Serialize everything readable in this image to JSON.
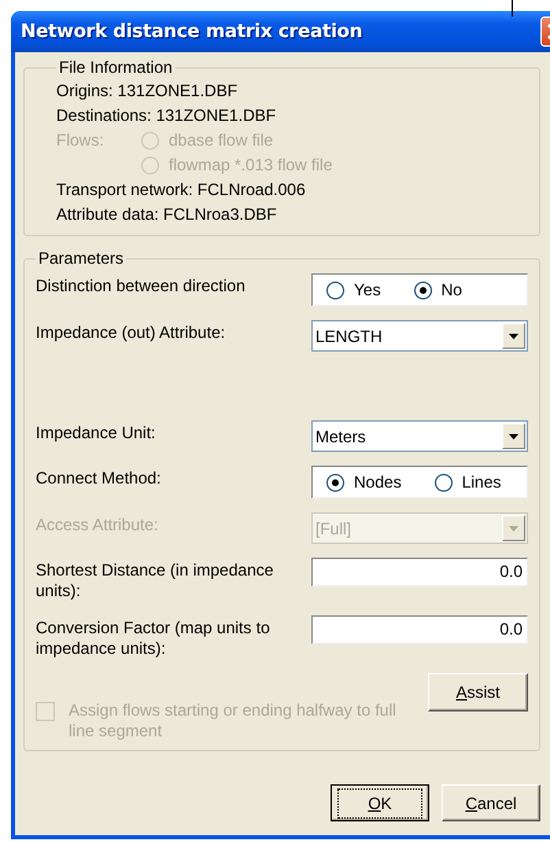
{
  "window": {
    "title": "Network distance matrix creation"
  },
  "file_info": {
    "title": "File Information",
    "items": [
      {
        "kind": "text",
        "text": "Origins: 131ZONE1.DBF"
      },
      {
        "kind": "text",
        "text": "Destinations: 131ZONE1.DBF"
      },
      {
        "kind": "radios",
        "label": "Flows:",
        "disabled": true,
        "options": [
          {
            "label": "dbase flow file",
            "selected": false
          },
          {
            "label": "flowmap *.013 flow file",
            "selected": false
          }
        ]
      },
      {
        "kind": "text",
        "text": "Transport network: FCLNroad.006"
      },
      {
        "kind": "text",
        "text": "Attribute data: FCLNroa3.DBF"
      }
    ]
  },
  "parameters": {
    "title": "Parameters",
    "rows": [
      {
        "kind": "radio",
        "label": "Distinction between direction",
        "disabled": false,
        "options": [
          {
            "label": "Yes",
            "selected": false
          },
          {
            "label": "No",
            "selected": true
          }
        ]
      },
      {
        "kind": "dropdown",
        "label": "Impedance (out) Attribute:",
        "value": "LENGTH",
        "disabled": false
      },
      {
        "kind": "dropdown",
        "label": "Impedance Unit:",
        "value": "Meters",
        "disabled": false
      },
      {
        "kind": "radio",
        "label": "Connect Method:",
        "disabled": false,
        "options": [
          {
            "label": "Nodes",
            "selected": true
          },
          {
            "label": "Lines",
            "selected": false
          }
        ]
      },
      {
        "kind": "dropdown",
        "label": "Access Attribute:",
        "value": "[Full]",
        "disabled": true
      },
      {
        "kind": "number",
        "label": "Shortest Distance (in impedance units):",
        "value": "0.0",
        "disabled": false
      },
      {
        "kind": "number",
        "label": "Conversion Factor (map units to impedance units):",
        "value": "0.0",
        "disabled": false
      }
    ],
    "checkbox": {
      "label": "Assign flows starting or ending halfway to full line segment",
      "checked": false,
      "disabled": true
    },
    "assist": {
      "label": "Assist"
    }
  },
  "buttons": [
    {
      "label": "OK",
      "default": true
    },
    {
      "label": "Cancel",
      "default": false
    }
  ]
}
